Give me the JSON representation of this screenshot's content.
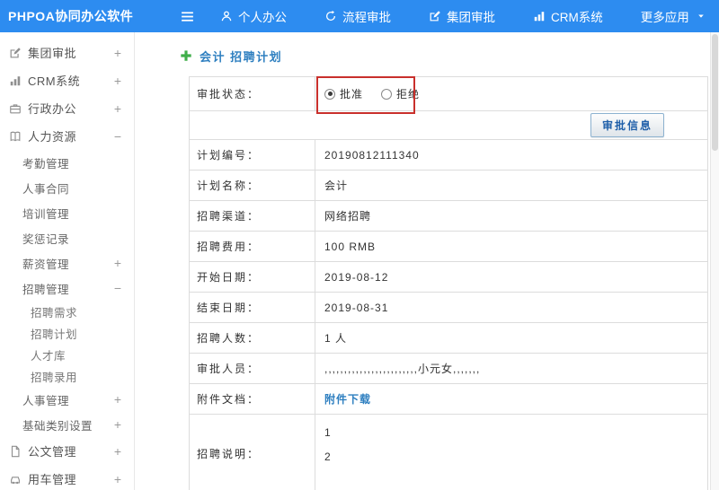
{
  "topbar": {
    "brand": "PHPOA协同办公软件",
    "menu_icon": "hamburger-icon",
    "items": [
      {
        "name": "personal-office",
        "label": "个人办公",
        "icon": "person-icon"
      },
      {
        "name": "workflow-approval",
        "label": "流程审批",
        "icon": "process-icon"
      },
      {
        "name": "group-approval",
        "label": "集团审批",
        "icon": "edit-icon"
      },
      {
        "name": "crm-system",
        "label": "CRM系统",
        "icon": "chart-icon"
      },
      {
        "name": "more-apps",
        "label": "更多应用",
        "icon": "",
        "caret": true
      }
    ]
  },
  "sidebar": {
    "items": [
      {
        "name": "group-approval",
        "label": "集团审批",
        "icon": "edit-icon",
        "level": 1,
        "expander": "+"
      },
      {
        "name": "crm-system",
        "label": "CRM系统",
        "icon": "chart-icon",
        "level": 1,
        "expander": "+"
      },
      {
        "name": "administration",
        "label": "行政办公",
        "icon": "briefcase-icon",
        "level": 1,
        "expander": "+"
      },
      {
        "name": "human-resources",
        "label": "人力资源",
        "icon": "book-icon",
        "level": 1,
        "expander": "−"
      },
      {
        "name": "attendance",
        "label": "考勤管理",
        "level": 2
      },
      {
        "name": "hr-contract",
        "label": "人事合同",
        "level": 2
      },
      {
        "name": "training",
        "label": "培训管理",
        "level": 2
      },
      {
        "name": "rewards-records",
        "label": "奖惩记录",
        "level": 2
      },
      {
        "name": "salary-management",
        "label": "薪资管理",
        "level": 2,
        "expander": "+"
      },
      {
        "name": "recruit-management",
        "label": "招聘管理",
        "level": 2,
        "expander": "−"
      },
      {
        "name": "recruit-demand",
        "label": "招聘需求",
        "level": 3
      },
      {
        "name": "recruit-plan",
        "label": "招聘计划",
        "level": 3
      },
      {
        "name": "talent-pool",
        "label": "人才库",
        "level": 3
      },
      {
        "name": "recruit-hiring",
        "label": "招聘录用",
        "level": 3
      },
      {
        "name": "personnel-management",
        "label": "人事管理",
        "level": 2,
        "expander": "+"
      },
      {
        "name": "base-category-settings",
        "label": "基础类别设置",
        "level": 2,
        "expander": "+"
      },
      {
        "name": "document-management",
        "label": "公文管理",
        "icon": "doc-icon",
        "level": 1,
        "expander": "+"
      },
      {
        "name": "vehicle-management",
        "label": "用车管理",
        "icon": "car-icon",
        "level": 1,
        "expander": "+"
      }
    ]
  },
  "main": {
    "title": "会计 招聘计划",
    "title_icon": "plus-icon",
    "status_row": {
      "label": "审批状态：",
      "options": [
        {
          "name": "approve",
          "label": "批准",
          "checked": true
        },
        {
          "name": "reject",
          "label": "拒绝",
          "checked": false
        }
      ]
    },
    "approve_button": "审批信息",
    "fields": [
      {
        "name": "plan-number",
        "label": "计划编号：",
        "value": "20190812111340"
      },
      {
        "name": "plan-name",
        "label": "计划名称：",
        "value": "会计"
      },
      {
        "name": "recruit-channel",
        "label": "招聘渠道：",
        "value": "网络招聘"
      },
      {
        "name": "recruit-cost",
        "label": "招聘费用：",
        "value": "100 RMB"
      },
      {
        "name": "start-date",
        "label": "开始日期：",
        "value": "2019-08-12"
      },
      {
        "name": "end-date",
        "label": "结束日期：",
        "value": "2019-08-31"
      },
      {
        "name": "recruit-count",
        "label": "招聘人数：",
        "value": "1 人"
      },
      {
        "name": "approvers",
        "label": "审批人员：",
        "value": ",,,,,,,,,,,,,,,,,,,,,,,,小元女,,,,,,,"
      },
      {
        "name": "attachment",
        "label": "附件文档：",
        "value": "附件下载",
        "type": "link"
      },
      {
        "name": "recruit-description",
        "label": "招聘说明：",
        "value": [
          "1",
          "2"
        ],
        "type": "multiline"
      }
    ],
    "colors": {
      "topbar_blue": "#2d8cf0",
      "title_blue": "#2e7fc0",
      "link_blue": "#2e7fc0",
      "annotation_red": "#c9302c",
      "plus_green": "#3fae49"
    }
  }
}
